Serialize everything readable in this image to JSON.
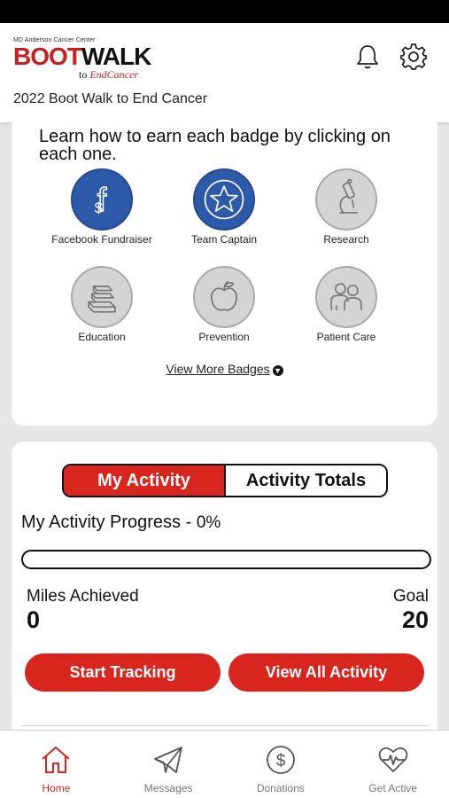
{
  "header": {
    "logo_top": "MD Anderson Cancer Center",
    "logo_boot": "BOOT",
    "logo_walk": "WALK",
    "logo_sub_to": "to",
    "logo_sub_end": "EndCancer",
    "event_title": "2022 Boot Walk to End Cancer",
    "icons": [
      "bell-icon",
      "gear-icon"
    ]
  },
  "badges": {
    "intro": "Learn how to earn each badge by clicking on each one.",
    "items": [
      {
        "label": "Facebook Fundraiser",
        "icon": "facebook-dollar-icon",
        "earned": true
      },
      {
        "label": "Team Captain",
        "icon": "star-icon",
        "earned": true
      },
      {
        "label": "Research",
        "icon": "microscope-icon",
        "earned": false
      },
      {
        "label": "Education",
        "icon": "books-icon",
        "earned": false
      },
      {
        "label": "Prevention",
        "icon": "apple-icon",
        "earned": false
      },
      {
        "label": "Patient Care",
        "icon": "people-icon",
        "earned": false
      }
    ],
    "view_more": "View More Badges"
  },
  "activity": {
    "tabs": [
      {
        "label": "My Activity",
        "active": true
      },
      {
        "label": "Activity Totals",
        "active": false
      }
    ],
    "progress_title": "My Activity Progress -",
    "progress_pct": "0%",
    "progress_value": 0,
    "miles_label": "Miles Achieved",
    "miles_value": "0",
    "goal_label": "Goal",
    "goal_value": "20",
    "start_button": "Start Tracking",
    "view_button": "View All Activity"
  },
  "tabbar": {
    "items": [
      {
        "label": "Home",
        "icon": "home-icon",
        "active": true
      },
      {
        "label": "Messages",
        "icon": "paper-plane-icon",
        "active": false
      },
      {
        "label": "Donations",
        "icon": "dollar-circle-icon",
        "active": false
      },
      {
        "label": "Get Active",
        "icon": "heart-pulse-icon",
        "active": false
      }
    ]
  },
  "colors": {
    "brand_red": "#d8261f",
    "badge_blue": "#2d5aa8",
    "badge_gray": "#d4d4d4"
  }
}
